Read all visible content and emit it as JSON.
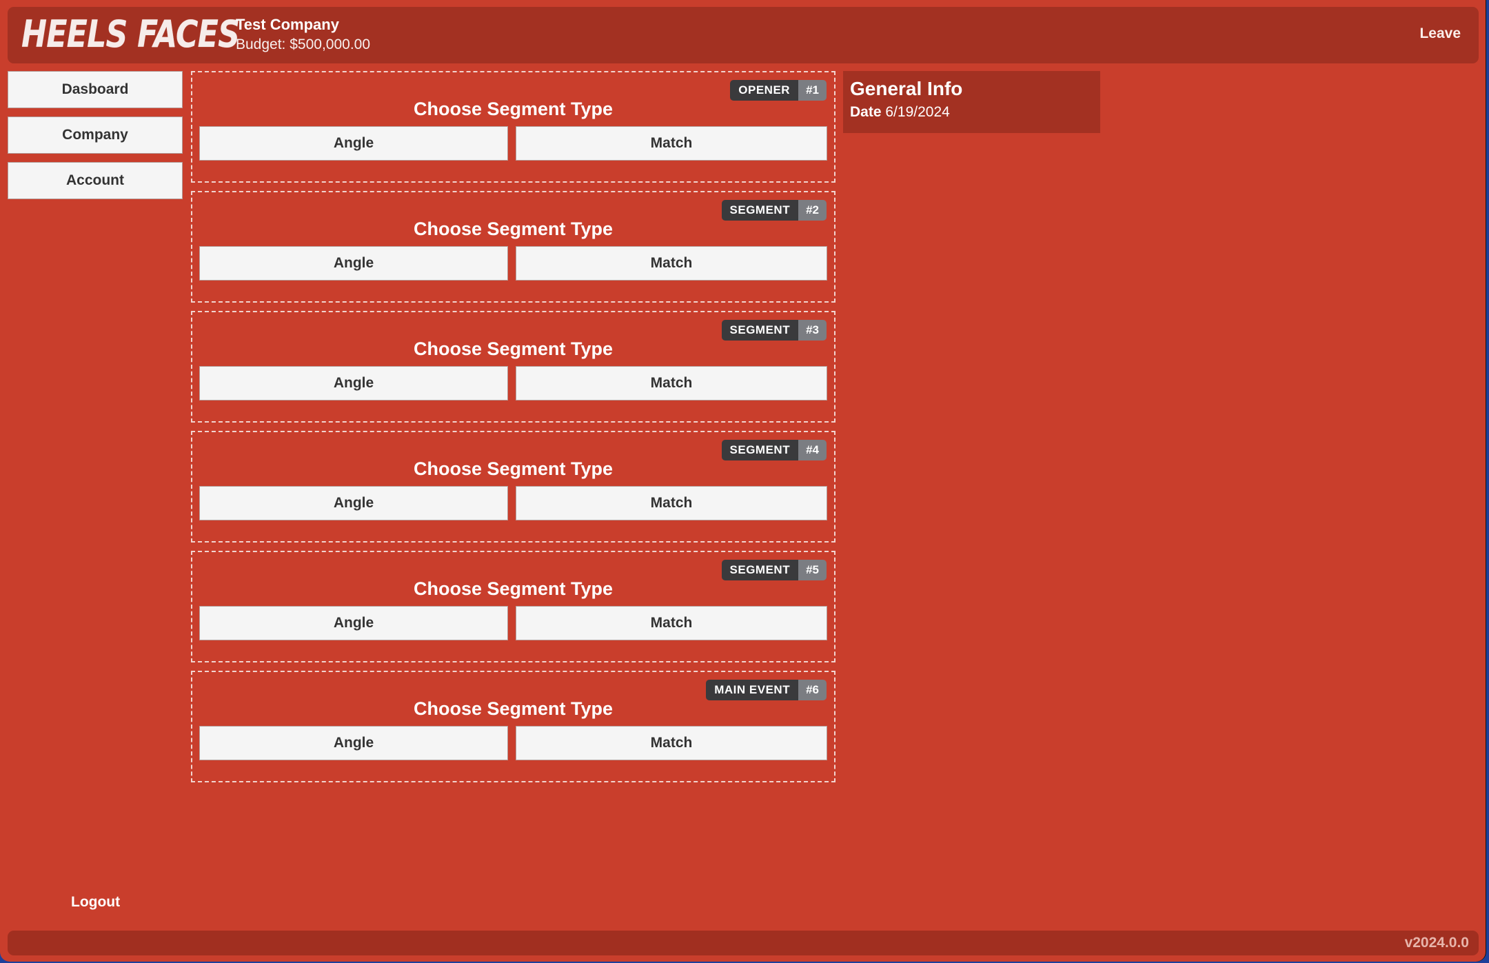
{
  "header": {
    "logo_text": "HEELS FACES",
    "company_name": "Test Company",
    "budget": "Budget: $500,000.00",
    "leave_label": "Leave"
  },
  "sidebar": {
    "items": [
      {
        "label": "Dasboard"
      },
      {
        "label": "Company"
      },
      {
        "label": "Account"
      }
    ],
    "logout_label": "Logout"
  },
  "segments": [
    {
      "type": "OPENER",
      "number": "#1",
      "title": "Choose Segment Type",
      "angle_label": "Angle",
      "match_label": "Match"
    },
    {
      "type": "SEGMENT",
      "number": "#2",
      "title": "Choose Segment Type",
      "angle_label": "Angle",
      "match_label": "Match"
    },
    {
      "type": "SEGMENT",
      "number": "#3",
      "title": "Choose Segment Type",
      "angle_label": "Angle",
      "match_label": "Match"
    },
    {
      "type": "SEGMENT",
      "number": "#4",
      "title": "Choose Segment Type",
      "angle_label": "Angle",
      "match_label": "Match"
    },
    {
      "type": "SEGMENT",
      "number": "#5",
      "title": "Choose Segment Type",
      "angle_label": "Angle",
      "match_label": "Match"
    },
    {
      "type": "MAIN EVENT",
      "number": "#6",
      "title": "Choose Segment Type",
      "angle_label": "Angle",
      "match_label": "Match"
    }
  ],
  "general_info": {
    "title": "General Info",
    "date_label": "Date",
    "date_value": "6/19/2024"
  },
  "footer": {
    "version": "v2024.0.0"
  },
  "colors": {
    "background": "#c93e2c",
    "panel": "#a33122",
    "badge_dark": "#3a3a3c",
    "badge_number": "#7b7d82",
    "button": "#f5f5f5"
  }
}
